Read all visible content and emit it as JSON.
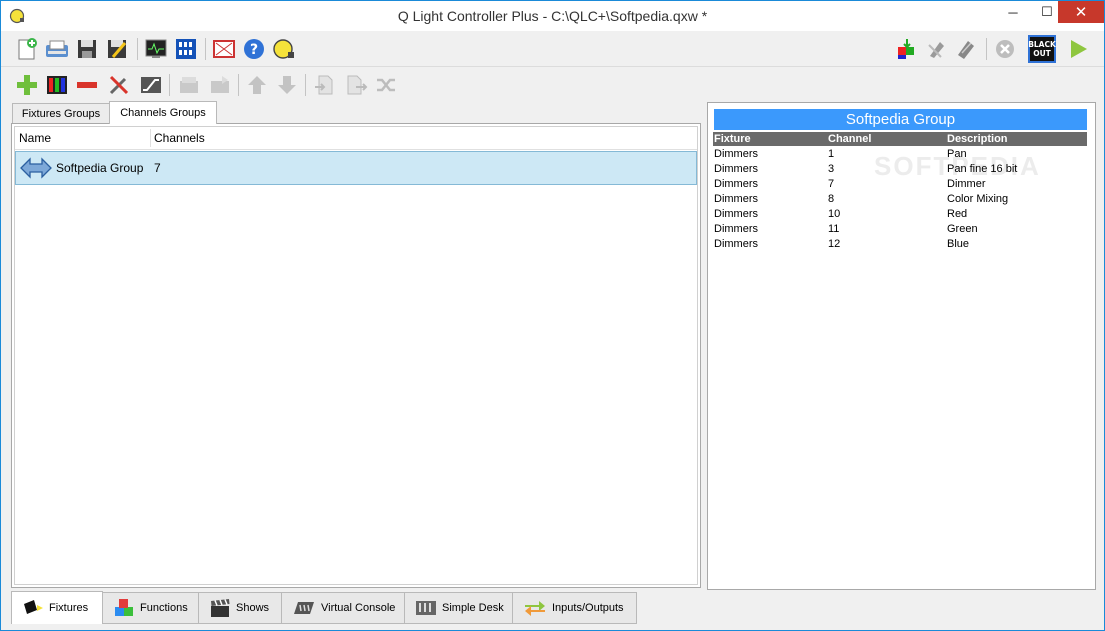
{
  "window": {
    "title": "Q Light Controller Plus - C:\\QLC+\\Softpedia.qxw *",
    "min": "─",
    "max": "☐",
    "close": "✕"
  },
  "toolbar_main": [
    "new-file-icon",
    "open-icon",
    "save-icon",
    "save-as-icon",
    "monitor-icon",
    "address-tool-icon",
    "fullscreen-icon",
    "help-icon",
    "about-icon",
    "live-edit-icon",
    "dmx-dump-icon",
    "fixture-remap-icon",
    "stop-functions-icon",
    "blackout-icon",
    "operate-mode-icon"
  ],
  "toolbar_main_blackout_label": "BLACK OUT",
  "tabs": {
    "fixtures_groups": "Fixtures Groups",
    "channels_groups": "Channels Groups"
  },
  "list": {
    "columns": [
      "Name",
      "Channels"
    ],
    "rows": [
      {
        "name": "Softpedia Group",
        "channels": "7"
      }
    ]
  },
  "detail": {
    "title": "Softpedia Group",
    "headers": [
      "Fixture",
      "Channel",
      "Description"
    ],
    "rows": [
      [
        "Dimmers",
        "1",
        "Pan"
      ],
      [
        "Dimmers",
        "3",
        "Pan fine 16 bit"
      ],
      [
        "Dimmers",
        "7",
        "Dimmer"
      ],
      [
        "Dimmers",
        "8",
        "Color Mixing"
      ],
      [
        "Dimmers",
        "10",
        "Red"
      ],
      [
        "Dimmers",
        "11",
        "Green"
      ],
      [
        "Dimmers",
        "12",
        "Blue"
      ]
    ]
  },
  "bottom_tabs": [
    {
      "label": "Fixtures",
      "active": true
    },
    {
      "label": "Functions"
    },
    {
      "label": "Shows"
    },
    {
      "label": "Virtual Console"
    },
    {
      "label": "Simple Desk"
    },
    {
      "label": "Inputs/Outputs"
    }
  ],
  "watermark": "SOFTPEDIA",
  "colors": {
    "accent": "#3b99fc",
    "selection": "#cde8f5",
    "close": "#c7382b"
  }
}
